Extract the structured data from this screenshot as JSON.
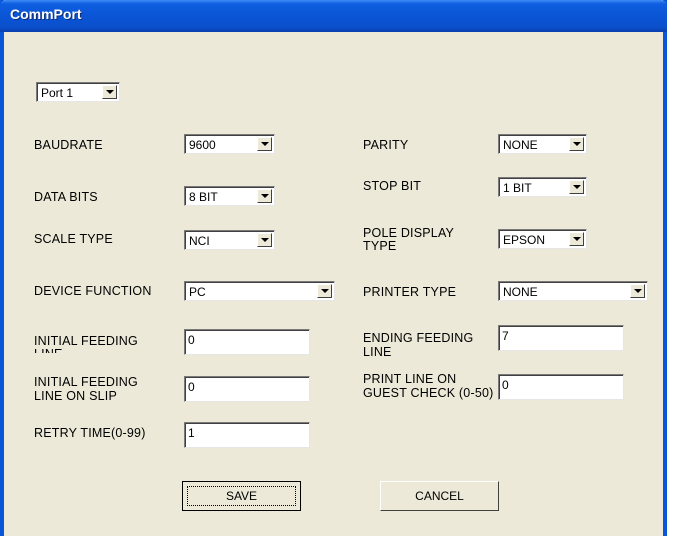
{
  "window": {
    "title": "CommPort"
  },
  "port": {
    "value": "Port 1"
  },
  "fields": {
    "baudrate": {
      "label": "BAUDRATE",
      "value": "9600"
    },
    "parity": {
      "label": "PARITY",
      "value": "NONE"
    },
    "data_bits": {
      "label": "DATA BITS",
      "value": "8 BIT"
    },
    "stop_bit": {
      "label": "STOP BIT",
      "value": "1 BIT"
    },
    "scale_type": {
      "label": "SCALE TYPE",
      "value": "NCI"
    },
    "pole_display_type": {
      "label_line1": "POLE DISPLAY",
      "label_line2": "TYPE",
      "value": "EPSON"
    },
    "device_function": {
      "label": "DEVICE FUNCTION",
      "value": "PC"
    },
    "printer_type": {
      "label": "PRINTER TYPE",
      "value": "NONE"
    },
    "initial_feeding_line": {
      "label_line1": "INITIAL FEEDING",
      "label_line2": "LINE",
      "value": "0"
    },
    "ending_feeding_line": {
      "label_line1": "ENDING FEEDING",
      "label_line2": "LINE",
      "value": "7"
    },
    "initial_feeding_line_on_slip": {
      "label_line1": "INITIAL FEEDING",
      "label_line2": "LINE ON SLIP",
      "value": "0"
    },
    "print_line_on_guest_check": {
      "label_line1": "PRINT LINE ON",
      "label_line2": "GUEST CHECK (0-50)",
      "value": "0"
    },
    "retry_time": {
      "label": "RETRY TIME(0-99)",
      "value": "1"
    }
  },
  "buttons": {
    "save": "SAVE",
    "cancel": "CANCEL"
  },
  "colors": {
    "titlebar": "#0a55d6",
    "window_bg": "#ece9d8"
  }
}
